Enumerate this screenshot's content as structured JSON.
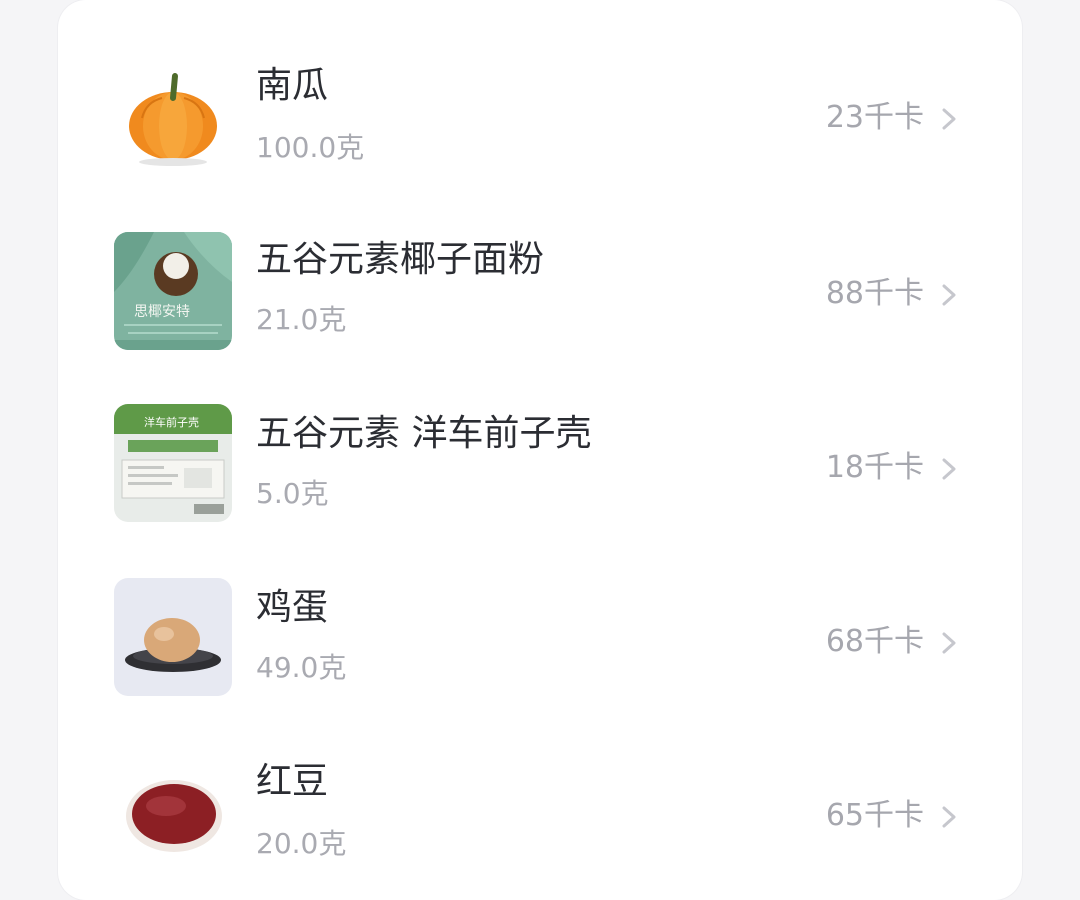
{
  "foods": [
    {
      "name": "南瓜",
      "weight": "100.0克",
      "calories": "23千卡",
      "icon": "pumpkin-icon"
    },
    {
      "name": "五谷元素椰子面粉",
      "weight": "21.0克",
      "calories": "88千卡",
      "icon": "coconut-flour-package-icon",
      "package_text": "思椰安特"
    },
    {
      "name": "五谷元素 洋车前子壳",
      "weight": "5.0克",
      "calories": "18千卡",
      "icon": "psyllium-husk-package-icon",
      "package_text": "洋车前子壳"
    },
    {
      "name": "鸡蛋",
      "weight": "49.0克",
      "calories": "68千卡",
      "icon": "egg-icon"
    },
    {
      "name": "红豆",
      "weight": "20.0克",
      "calories": "65千卡",
      "icon": "red-bean-icon"
    }
  ],
  "colors": {
    "title": "#2b2d33",
    "secondary": "#a9aab1",
    "card": "#ffffff",
    "background": "#f5f5f7"
  }
}
